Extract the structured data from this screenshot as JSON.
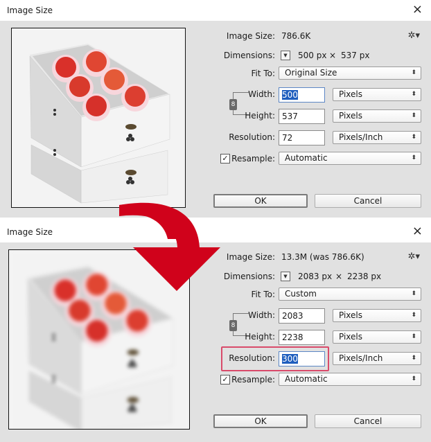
{
  "before": {
    "title": "Image Size",
    "image_size_label": "Image Size:",
    "image_size_value": "786.6K",
    "dimensions_label": "Dimensions:",
    "dimensions_width": "500 px",
    "dimensions_times": "×",
    "dimensions_height": "537 px",
    "fit_to_label": "Fit To:",
    "fit_to_value": "Original Size",
    "width_label": "Width:",
    "width_value": "500",
    "width_unit": "Pixels",
    "height_label": "Height:",
    "height_value": "537",
    "height_unit": "Pixels",
    "resolution_label": "Resolution:",
    "resolution_value": "72",
    "resolution_unit": "Pixels/Inch",
    "resample_label": "Resample:",
    "resample_checked": true,
    "resample_value": "Automatic",
    "ok_label": "OK",
    "cancel_label": "Cancel",
    "preview_blurred": false
  },
  "after": {
    "title": "Image Size",
    "image_size_label": "Image Size:",
    "image_size_value": "13.3M (was 786.6K)",
    "dimensions_label": "Dimensions:",
    "dimensions_width": "2083 px",
    "dimensions_times": "×",
    "dimensions_height": "2238 px",
    "fit_to_label": "Fit To:",
    "fit_to_value": "Custom",
    "width_label": "Width:",
    "width_value": "2083",
    "width_unit": "Pixels",
    "height_label": "Height:",
    "height_value": "2238",
    "height_unit": "Pixels",
    "resolution_label": "Resolution:",
    "resolution_value": "300",
    "resolution_unit": "Pixels/Inch",
    "resample_label": "Resample:",
    "resample_checked": true,
    "resample_value": "Automatic",
    "ok_label": "OK",
    "cancel_label": "Cancel",
    "preview_blurred": true
  },
  "icons": {
    "close": "×",
    "gear": "✲▾",
    "dimensions_dropdown": "▼",
    "select_arrows": "⬍",
    "chain": "8",
    "check": "✓"
  },
  "colors": {
    "arrow": "#d0021b",
    "highlight": "#d94a6a",
    "selection": "#1e5ebe",
    "dialog_bg": "#e1e1e1"
  }
}
